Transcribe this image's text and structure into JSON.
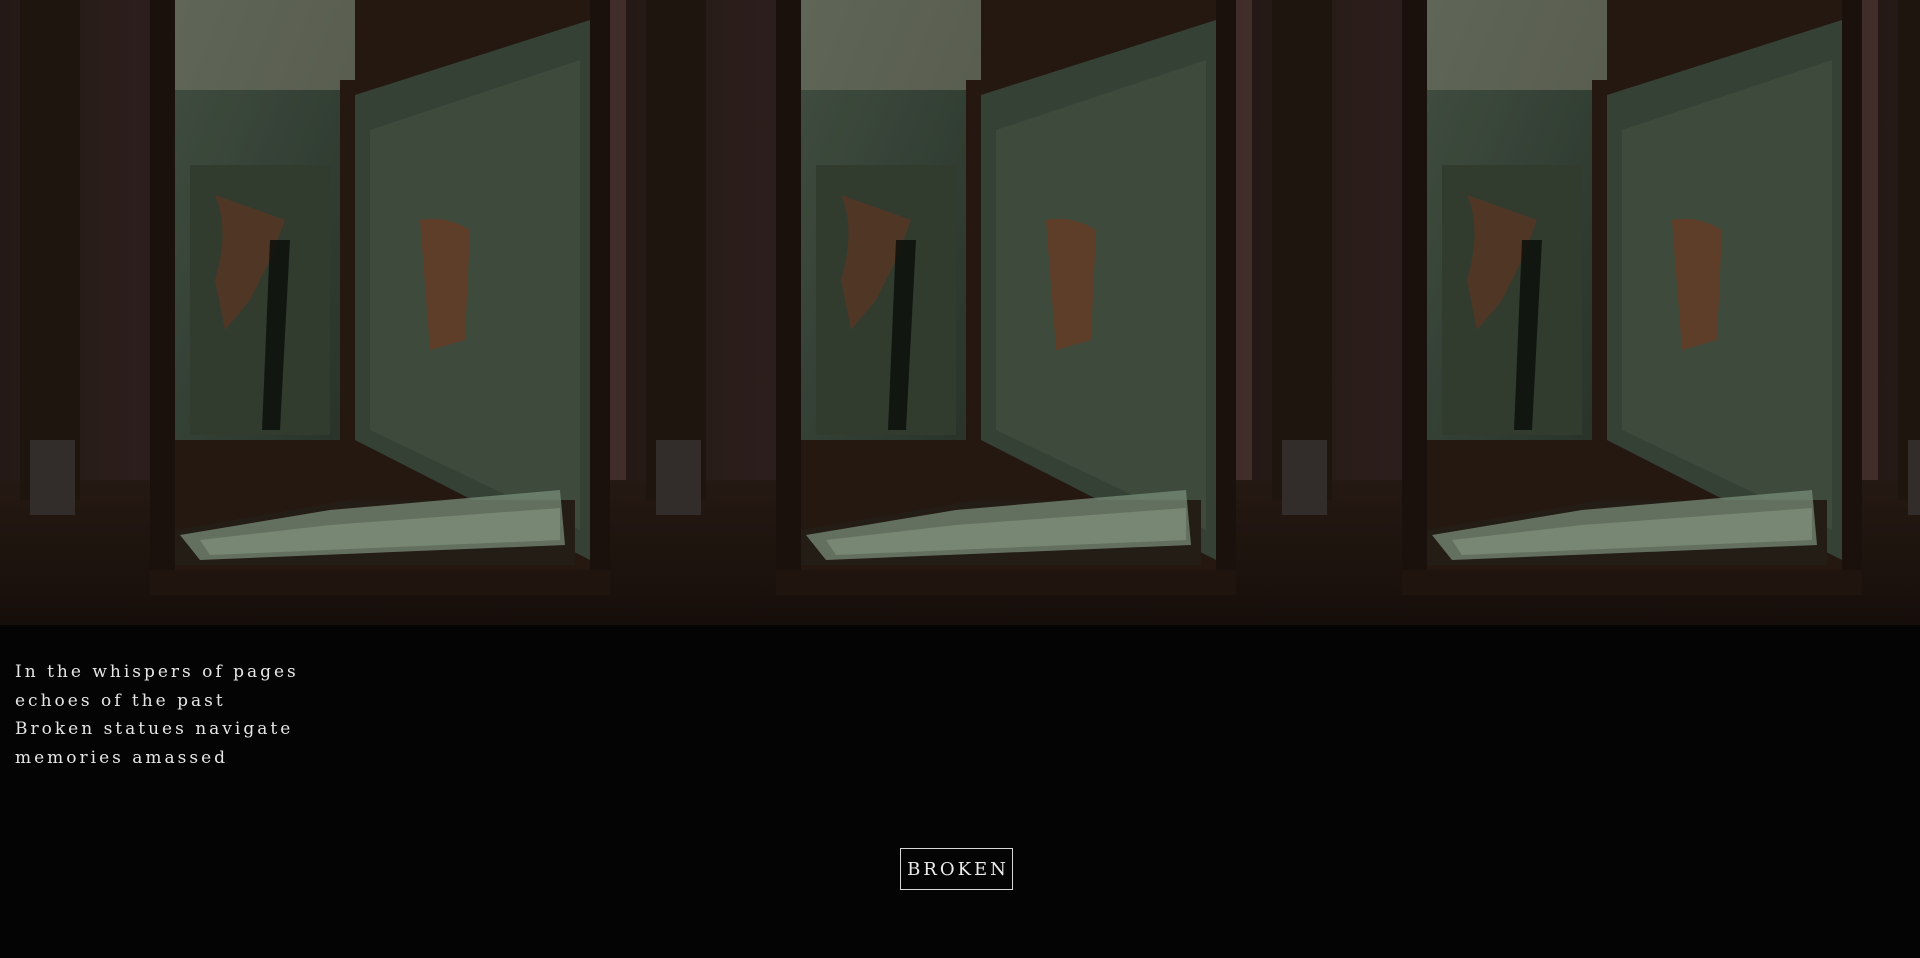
{
  "poem": {
    "lines": [
      "In the whispers of pages",
      "echoes of the past",
      "Broken statues navigate",
      "memories amassed"
    ]
  },
  "button": {
    "label": "BROKEN"
  },
  "banner": {
    "tile_count": 4,
    "image_description_icon": "broken-mirror-room-image"
  },
  "colors": {
    "background": "#050405",
    "text": "#e6e6e6",
    "button_border": "#d8d8d8",
    "wall": "#3b2a26",
    "mirror": "#3f4d40",
    "frame": "#2a1c14"
  }
}
